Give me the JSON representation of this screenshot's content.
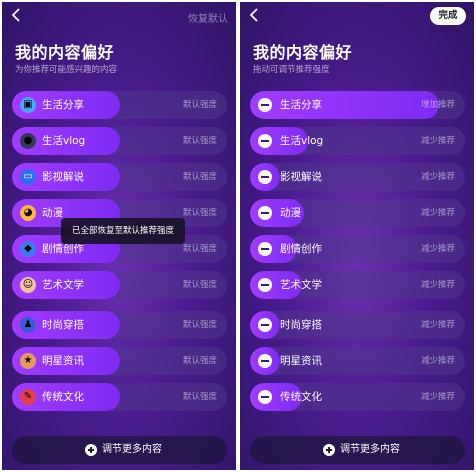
{
  "left_panel": {
    "top_action": "恢复默认",
    "title": "我的内容偏好",
    "subtitle": "为你推荐可能感兴趣的内容",
    "items": [
      {
        "label": "生活分享",
        "status": "默认强度",
        "icon": "share-icon",
        "level": 0.5
      },
      {
        "label": "生活vlog",
        "status": "默认强度",
        "icon": "camera-icon",
        "level": 0.5
      },
      {
        "label": "影视解说",
        "status": "默认强度",
        "icon": "tv-icon",
        "level": 0.5
      },
      {
        "label": "动漫",
        "status": "默认强度",
        "icon": "anime-icon",
        "level": 0.5
      },
      {
        "label": "剧情创作",
        "status": "默认强度",
        "icon": "drama-icon",
        "level": 0.5
      },
      {
        "label": "艺术文学",
        "status": "默认强度",
        "icon": "art-icon",
        "level": 0.5
      },
      {
        "label": "时尚穿搭",
        "status": "默认强度",
        "icon": "fashion-icon",
        "level": 0.5
      },
      {
        "label": "明星资讯",
        "status": "默认强度",
        "icon": "star-icon",
        "level": 0.5
      },
      {
        "label": "传统文化",
        "status": "默认强度",
        "icon": "culture-icon",
        "level": 0.5
      }
    ],
    "toast": "已全部恢复至默认推荐强度",
    "bottom_button": "调节更多内容"
  },
  "right_panel": {
    "top_action": "完成",
    "title": "我的内容偏好",
    "subtitle": "拖动可调节推荐强度",
    "items": [
      {
        "label": "生活分享",
        "status": "增加推荐",
        "level": 0.88
      },
      {
        "label": "生活vlog",
        "status": "减少推荐",
        "level": 0.27
      },
      {
        "label": "影视解说",
        "status": "减少推荐",
        "level": 0.14
      },
      {
        "label": "动漫",
        "status": "减少推荐",
        "level": 0.25
      },
      {
        "label": "剧情创作",
        "status": "减少推荐",
        "level": 0.22
      },
      {
        "label": "艺术文学",
        "status": "减少推荐",
        "level": 0.24
      },
      {
        "label": "时尚穿搭",
        "status": "减少推荐",
        "level": 0.14
      },
      {
        "label": "明星资讯",
        "status": "减少推荐",
        "level": 0.14
      },
      {
        "label": "传统文化",
        "status": "减少推荐",
        "level": 0.24
      }
    ],
    "bottom_button": "调节更多内容"
  }
}
